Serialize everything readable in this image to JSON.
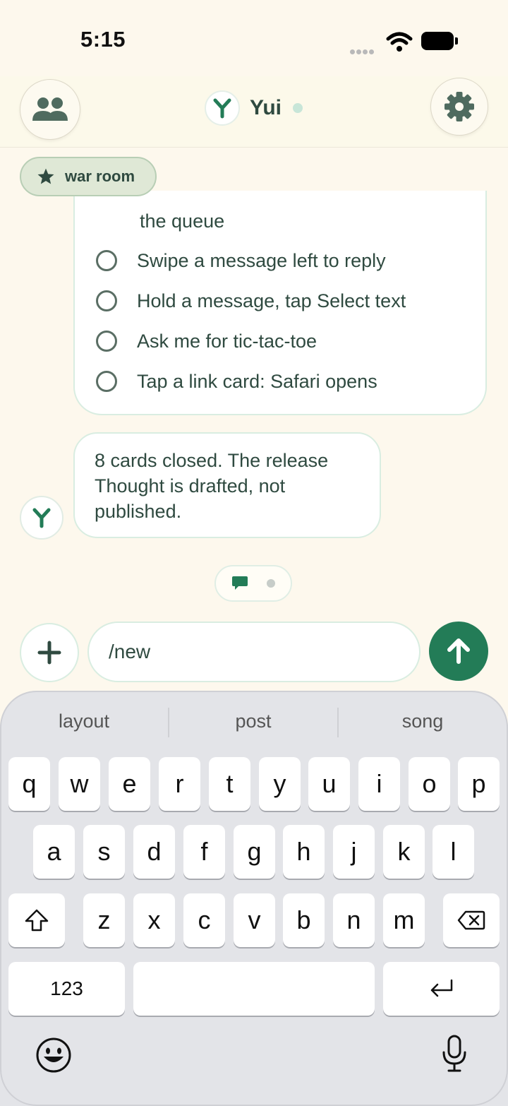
{
  "status_bar": {
    "time": "5:15"
  },
  "header": {
    "title": "Yui"
  },
  "room_chip": {
    "label": "war room"
  },
  "checklist": {
    "continued_text": "the queue",
    "items": [
      "Swipe a message left to reply",
      "Hold a message, tap Select text",
      "Ask me for tic-tac-toe",
      "Tap a link card: Safari opens"
    ]
  },
  "message": {
    "lines": [
      "8 cards closed. The release",
      "Thought is drafted, not",
      "published."
    ]
  },
  "composer": {
    "value": "/new"
  },
  "keyboard": {
    "suggestions": [
      "layout",
      "post",
      "song"
    ],
    "row1": [
      "q",
      "w",
      "e",
      "r",
      "t",
      "y",
      "u",
      "i",
      "o",
      "p"
    ],
    "row2": [
      "a",
      "s",
      "d",
      "f",
      "g",
      "h",
      "j",
      "k",
      "l"
    ],
    "row3": [
      "z",
      "x",
      "c",
      "v",
      "b",
      "n",
      "m"
    ],
    "numbers_key": "123"
  },
  "colors": {
    "accent": "#237c57",
    "text": "#2f4a40",
    "background": "#fdf8ed"
  },
  "icons": {
    "people": "people-icon",
    "settings": "gear-icon",
    "star": "star-icon",
    "plus": "plus-icon",
    "send": "arrow-up-icon",
    "shift": "shift-icon",
    "delete": "backspace-icon",
    "return": "return-icon",
    "emoji": "emoji-icon",
    "mic": "microphone-icon"
  }
}
